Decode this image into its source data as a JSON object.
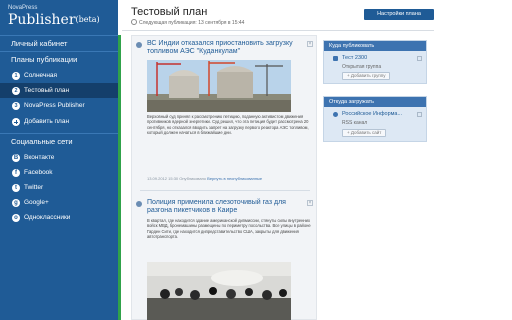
{
  "brand": {
    "small": "NovaPress",
    "big": "Publisher",
    "beta": "(beta)"
  },
  "sidebar": {
    "cabinet": "Личный кабинет",
    "plans_head": "Планы публикации",
    "plans": [
      {
        "label": "Солнечная",
        "num": "1"
      },
      {
        "label": "Тестовый план",
        "num": "2"
      },
      {
        "label": "NovaPress Publisher",
        "num": "3"
      },
      {
        "label": "Добавить план"
      }
    ],
    "social_head": "Социальные сети",
    "social": [
      {
        "label": "Вконтакте",
        "glyph": "В"
      },
      {
        "label": "Facebook",
        "glyph": "f"
      },
      {
        "label": "Twitter",
        "glyph": "t"
      },
      {
        "label": "Google+",
        "glyph": "g"
      },
      {
        "label": "Одноклассники",
        "glyph": "о"
      }
    ]
  },
  "header": {
    "title": "Тестовый план",
    "next_pub": "Следующая публикация: 13 сентября в 15:44",
    "settings_button": "Настройки плана"
  },
  "posts": [
    {
      "title": "ВС Индии отказался приостановить загрузку топливом АЭС \"Куданкулам\"",
      "text": "Верховный суд принял к рассмотрению петицию, поданную активистом движения противников ядерной энергетики. Суд решил, что эта петиция будет рассмотрена 20 сентября, но отказался вводить запрет на загрузку первого реактора АЭС топливом, который должен начаться в ближайшие дни.",
      "meta_date": "13.09.2012 15:30",
      "meta_status": "Опубликовано",
      "meta_link": "Вернуть в неопубликованные"
    },
    {
      "title": "Полиция применила слезоточивый газ для разгона пикетчиков в Каире",
      "text": "В квартал, где находится здание американской дипмиссии, стянуты силы внутренних войск МВД, бронемашины размещены по периметру посольства. Все улицы в районе Гарден Сити, где находится дипредставительство США, закрыты для движения автотранспорта."
    }
  ],
  "panels": {
    "where_head": "Куда публиковать",
    "where_item": "Тест 2300",
    "where_sub": "Открытая группа",
    "where_add": "+ Добавить группу",
    "from_head": "Откуда загружать",
    "from_item": "Российское Информа...",
    "from_sub": "RSS канал",
    "from_add": "+ Добавить сайт"
  }
}
